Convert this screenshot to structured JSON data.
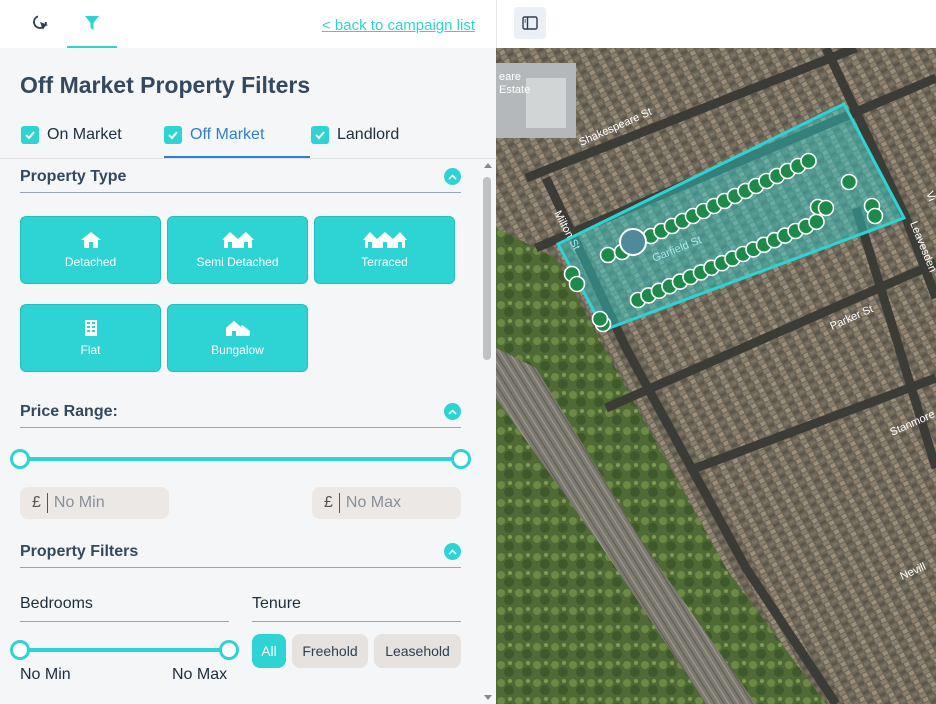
{
  "topbar": {
    "tabs": [
      {
        "icon": "cursor-click-icon"
      },
      {
        "icon": "filter-icon",
        "active": true
      }
    ],
    "back_link": "< back to campaign list"
  },
  "panel": {
    "title": "Off Market Property Filters",
    "market_tabs": [
      {
        "label": "On Market",
        "checked": true
      },
      {
        "label": "Off Market",
        "checked": true,
        "active": true
      },
      {
        "label": "Landlord",
        "checked": true
      }
    ]
  },
  "property_type": {
    "heading": "Property Type",
    "types": [
      {
        "label": "Detached",
        "icon": "house-icon"
      },
      {
        "label": "Semi Detached",
        "icon": "semi-detached-icon"
      },
      {
        "label": "Terraced",
        "icon": "terraced-icon"
      },
      {
        "label": "Flat",
        "icon": "flat-icon"
      },
      {
        "label": "Bungalow",
        "icon": "bungalow-icon"
      }
    ]
  },
  "price_range": {
    "heading": "Price Range:",
    "currency": "£",
    "min_placeholder": "No Min",
    "max_placeholder": "No Max",
    "slider": {
      "min": 0,
      "max": 1
    }
  },
  "property_filters": {
    "heading": "Property Filters",
    "bedrooms": {
      "heading": "Bedrooms",
      "min_label": "No Min",
      "max_label": "No Max"
    },
    "tenure": {
      "heading": "Tenure",
      "options": [
        "All",
        "Freehold",
        "Leasehold"
      ],
      "selected": "All"
    }
  },
  "map": {
    "streets": [
      "Shakespeare St",
      "Garfield St",
      "Milton St",
      "Parker St",
      "Leavesden",
      "Stanmore",
      "Nevill",
      "Vi"
    ],
    "estate_label_1": "eare",
    "estate_label_2": "Estate"
  },
  "colors": {
    "accent": "#2ed3d3",
    "active_tab": "#2f7fd0",
    "marker": "#1e8a4a",
    "polygon": "#2ed3d3"
  }
}
